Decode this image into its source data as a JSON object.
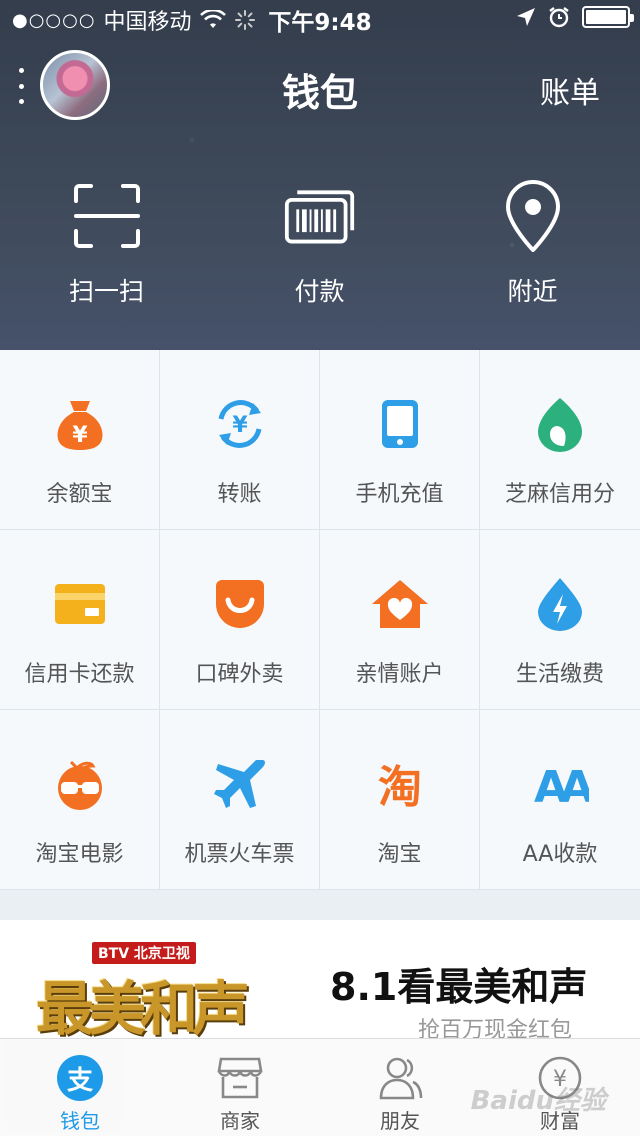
{
  "status_bar": {
    "signal": "●○○○○",
    "carrier": "中国移动",
    "time": "下午9:48",
    "battery_level": 1.0
  },
  "nav": {
    "title": "钱包",
    "right_action": "账单"
  },
  "quick_actions": [
    {
      "label": "扫一扫",
      "icon": "scan-icon"
    },
    {
      "label": "付款",
      "icon": "barcode-pay-icon"
    },
    {
      "label": "附近",
      "icon": "location-pin-icon"
    }
  ],
  "grid": [
    {
      "label": "余额宝",
      "icon": "money-bag-icon",
      "color": "#f36f21"
    },
    {
      "label": "转账",
      "icon": "transfer-icon",
      "color": "#2e9ee6"
    },
    {
      "label": "手机充值",
      "icon": "phone-icon",
      "color": "#2e9ee6"
    },
    {
      "label": "芝麻信用分",
      "icon": "sesame-icon",
      "color": "#2bb07e"
    },
    {
      "label": "信用卡还款",
      "icon": "credit-card-icon",
      "color": "#f5b11c"
    },
    {
      "label": "口碑外卖",
      "icon": "koubei-icon",
      "color": "#f36f21"
    },
    {
      "label": "亲情账户",
      "icon": "family-house-icon",
      "color": "#f36f21"
    },
    {
      "label": "生活缴费",
      "icon": "utility-drop-icon",
      "color": "#2e9ee6"
    },
    {
      "label": "淘宝电影",
      "icon": "movie-glasses-icon",
      "color": "#f36f21"
    },
    {
      "label": "机票火车票",
      "icon": "airplane-icon",
      "color": "#2e9ee6"
    },
    {
      "label": "淘宝",
      "icon": "taobao-icon",
      "color": "#f36f21"
    },
    {
      "label": "AA收款",
      "icon": "aa-icon",
      "color": "#2e9ee6"
    }
  ],
  "banner": {
    "tag": "BTV 北京卫视",
    "logo_text": "最美和声",
    "title": "8.1看最美和声",
    "subtitle": "抢百万现金红包"
  },
  "tabs": [
    {
      "label": "钱包",
      "icon": "wallet-alipay-icon",
      "active": true,
      "badge": "支"
    },
    {
      "label": "商家",
      "icon": "store-icon",
      "active": false
    },
    {
      "label": "朋友",
      "icon": "friends-icon",
      "active": false
    },
    {
      "label": "财富",
      "icon": "wealth-icon",
      "active": false
    }
  ],
  "watermark": "Baidu经验"
}
